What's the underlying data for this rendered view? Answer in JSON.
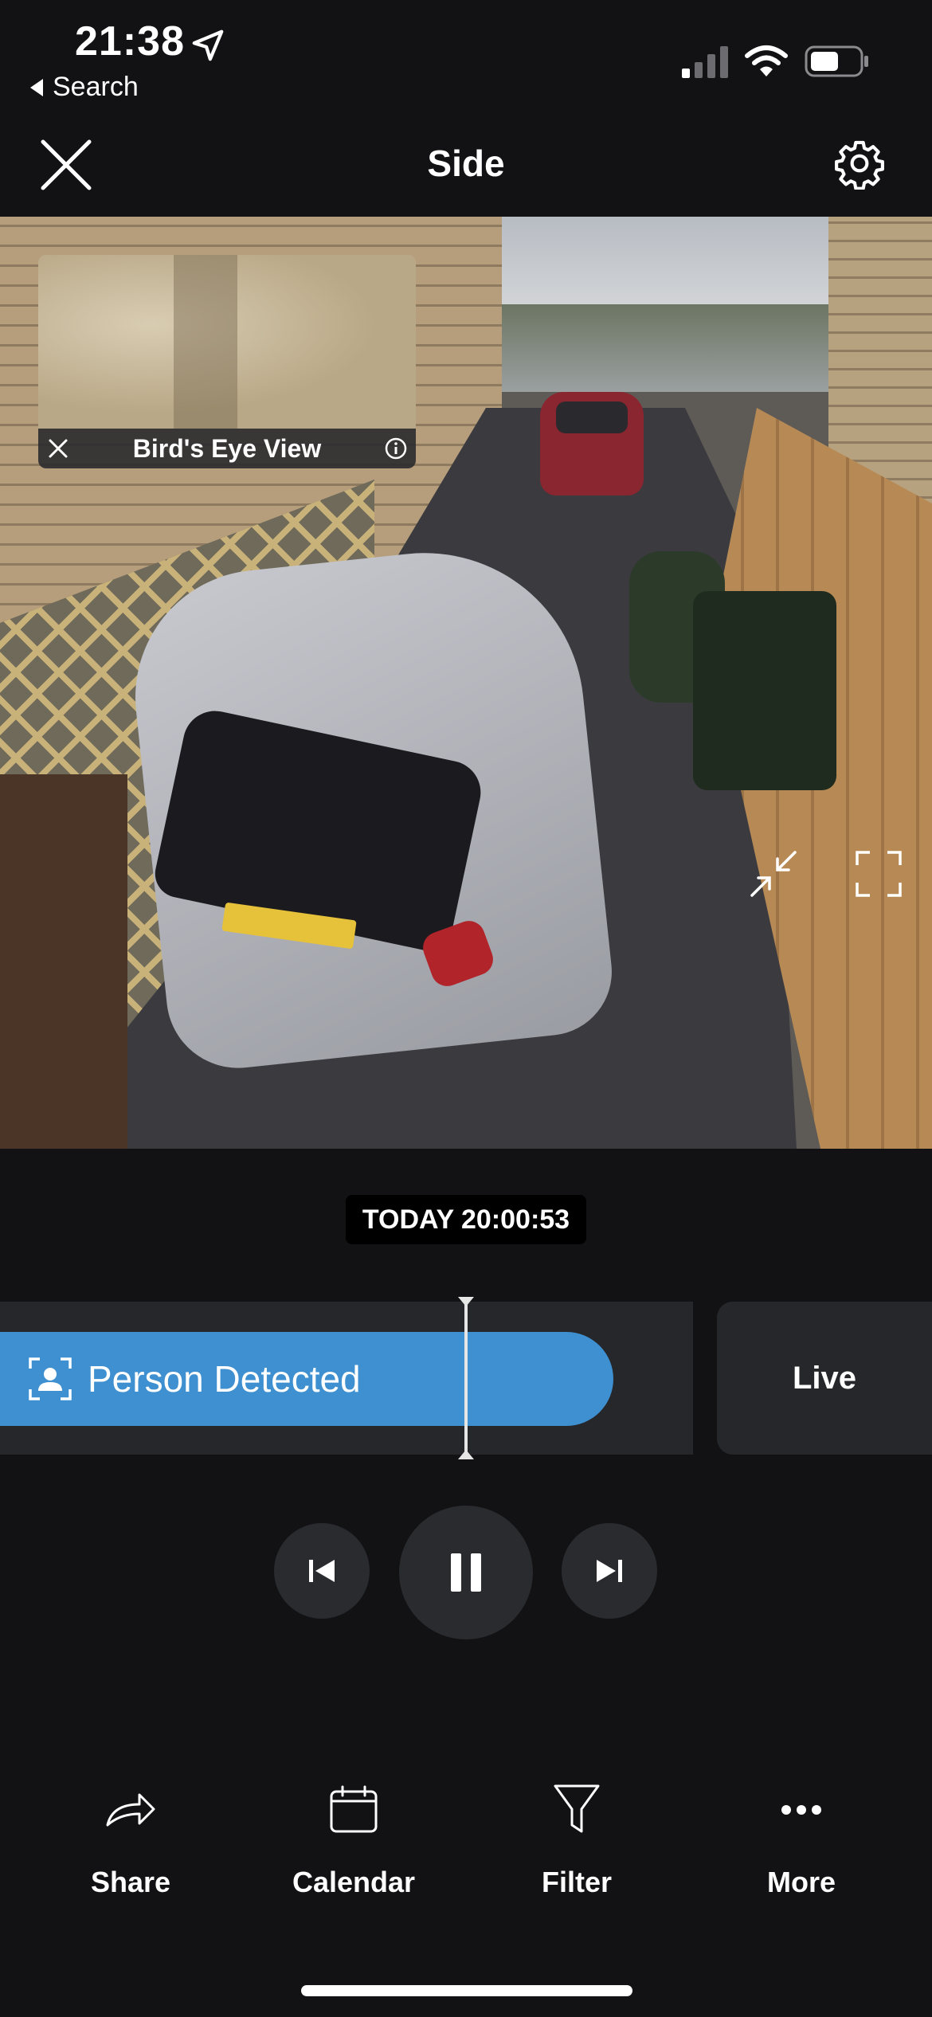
{
  "status_bar": {
    "time": "21:38",
    "back_label": "Search",
    "icons": [
      "location-arrow-icon",
      "cellular-signal-icon",
      "wifi-icon",
      "battery-icon"
    ]
  },
  "header": {
    "title": "Side",
    "close_icon": "close-icon",
    "settings_icon": "gear-icon"
  },
  "video": {
    "birds_eye_label": "Bird's Eye View",
    "icons": [
      "close-icon",
      "info-icon",
      "shrink-icon",
      "fullscreen-icon"
    ]
  },
  "timestamp": "TODAY 20:00:53",
  "timeline": {
    "event_label": "Person Detected",
    "event_icon": "person-icon",
    "event_color": "#3f90d0",
    "live_label": "Live"
  },
  "playback": {
    "icons": [
      "skip-back-icon",
      "pause-icon",
      "skip-forward-icon"
    ]
  },
  "actions": [
    {
      "label": "Share",
      "icon": "share-icon"
    },
    {
      "label": "Calendar",
      "icon": "calendar-icon"
    },
    {
      "label": "Filter",
      "icon": "filter-icon"
    },
    {
      "label": "More",
      "icon": "more-icon"
    }
  ],
  "colors": {
    "background": "#121214",
    "panel": "#26272b",
    "accent": "#3f90d0"
  }
}
